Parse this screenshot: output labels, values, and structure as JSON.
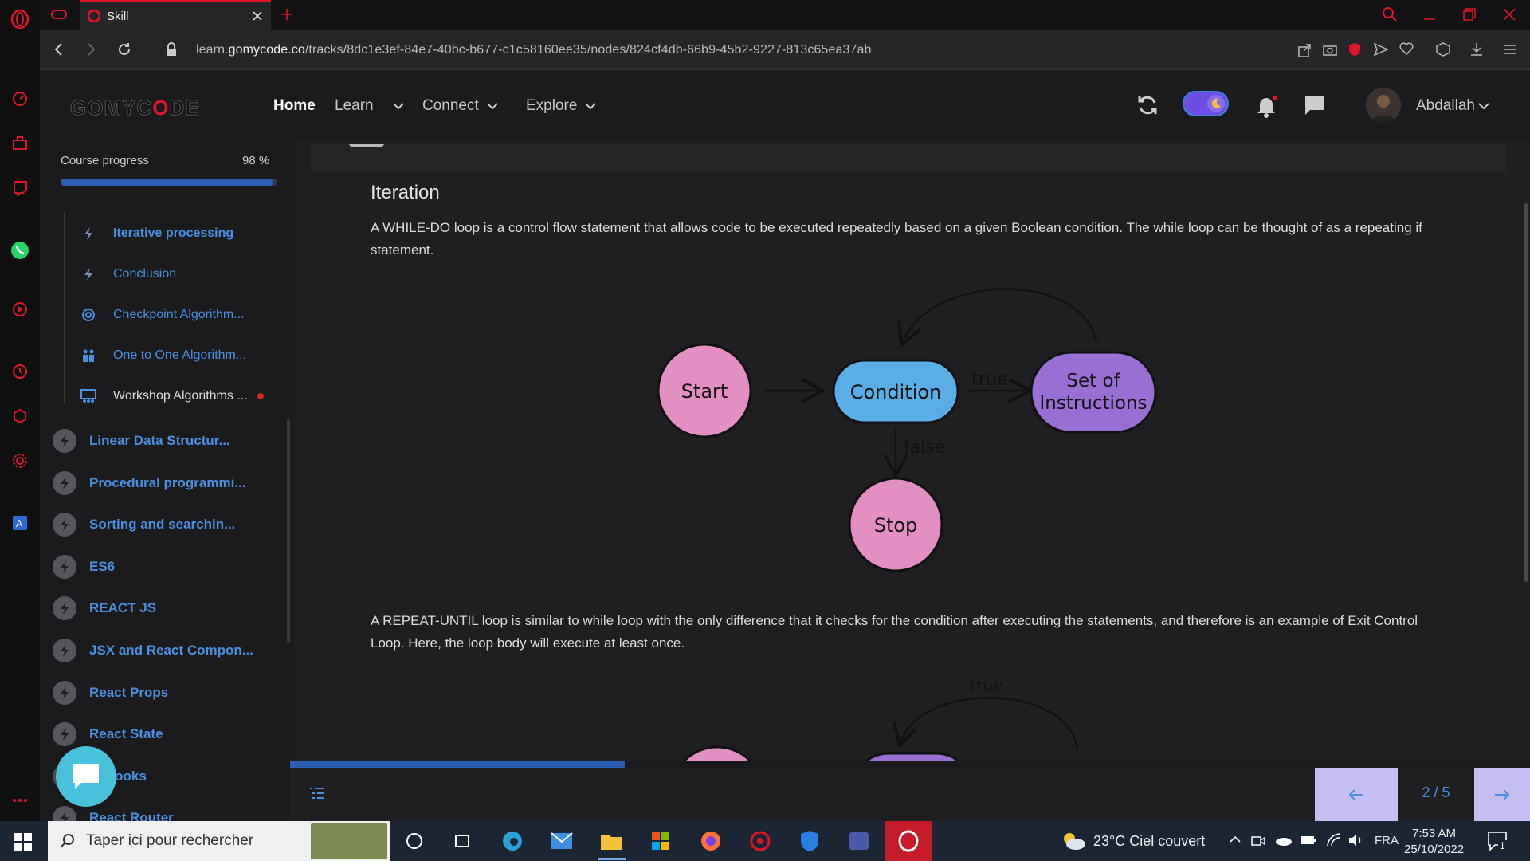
{
  "browser": {
    "tab_title": "Skill",
    "url_prefix": "learn.",
    "url_domain": "gomycode.co",
    "url_path": "/tracks/8dc1e3ef-84e7-40bc-b677-c1c58160ee35/nodes/824cf4db-66b9-45b2-9227-813c65ea37ab"
  },
  "site": {
    "logo_pre": "GOMYC",
    "logo_o": "O",
    "logo_post": "DE",
    "nav": {
      "home": "Home",
      "learn": "Learn",
      "connect": "Connect",
      "explore": "Explore"
    },
    "user_name": "Abdallah"
  },
  "sidebar": {
    "progress_label": "Course progress",
    "progress_value": "98 %",
    "progress_fraction": 0.98,
    "sub_items": [
      {
        "label": "Iterative processing",
        "icon": "bolt-icon"
      },
      {
        "label": "Conclusion",
        "icon": "bolt-icon"
      },
      {
        "label": "Checkpoint Algorithm...",
        "icon": "target-icon"
      },
      {
        "label": "One to One Algorithm...",
        "icon": "people-icon"
      },
      {
        "label": "Workshop Algorithms ...",
        "icon": "workshop-icon"
      }
    ],
    "modules": [
      {
        "label": "Linear Data Structur..."
      },
      {
        "label": "Procedural programmi..."
      },
      {
        "label": "Sorting and searchin..."
      },
      {
        "label": "ES6"
      },
      {
        "label": "REACT JS"
      },
      {
        "label": "JSX and React Compon..."
      },
      {
        "label": "React Props"
      },
      {
        "label": "React State"
      },
      {
        "label": "ct Hooks"
      },
      {
        "label": "React Router"
      }
    ]
  },
  "content": {
    "heading": "Iteration",
    "para1": "A WHILE-DO loop is a control flow statement that allows code to be executed repeatedly based on a given Boolean condition. The while loop can be thought of as a repeating if statement.",
    "para2": "A REPEAT-UNTIL loop is similar to while loop with the only difference that it checks for the condition after executing the statements, and therefore is an example of Exit Control Loop. Here, the loop body will execute at least once.",
    "diagram1": {
      "start": "Start",
      "condition": "Condition",
      "true_label": "true",
      "false_label": "false",
      "instructions_line1": "Set of",
      "instructions_line2": "Instructions",
      "stop": "Stop"
    },
    "diagram2": {
      "true_label": "true"
    },
    "page_counter": "2 / 5",
    "bottom_progress_fraction": 0.27
  },
  "taskbar": {
    "search_placeholder": "Taper ici pour rechercher",
    "weather": "23°C  Ciel couvert",
    "lang": "FRA",
    "time": "7:53 AM",
    "date": "25/10/2022",
    "notif_count": "1"
  },
  "colors": {
    "accent_blue": "#4b8fe2",
    "opera_red": "#e0152a",
    "pink_node": "#e48fc4",
    "blue_node": "#5aaee8",
    "purple_node": "#9a6fd4",
    "pager_bg": "#c5bef2"
  }
}
